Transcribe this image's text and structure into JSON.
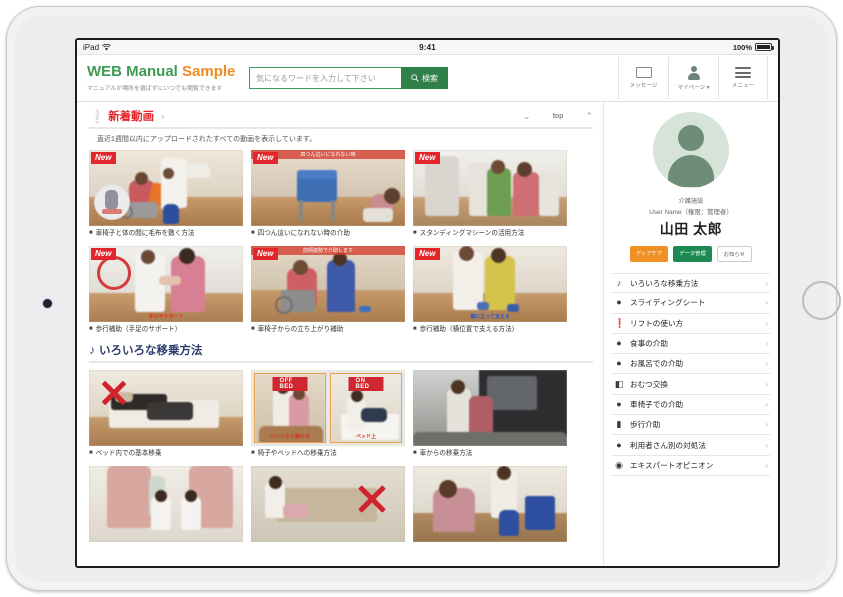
{
  "status_bar": {
    "carrier": "iPad",
    "wifi_icon": "wifi-icon",
    "time": "9:41",
    "battery_percent": "100%"
  },
  "header": {
    "brand_web": "WEB ",
    "brand_manual": "Manual ",
    "brand_sample": "Sample",
    "brand_subtitle": "マニュアルが場所を選ばずにいつでも閲覧できます",
    "search": {
      "placeholder": "気になるワードを入力して下さい",
      "value": "",
      "button_label": "検索",
      "button_icon": "search-icon"
    },
    "tools": [
      {
        "icon": "envelope-icon",
        "label": "メッセージ"
      },
      {
        "icon": "person-icon",
        "label": "マイページ ▾"
      },
      {
        "icon": "hamburger-icon",
        "label": "メニュー"
      }
    ]
  },
  "sections": [
    {
      "icon": "exclamation-icon",
      "title": "新着動画",
      "chevron": "›",
      "description": "直近1週間以内にアップロードされたすべての動画を表示しています。",
      "controls": {
        "down": "⌄",
        "top": "top",
        "up": "⌃"
      },
      "rows": [
        [
          {
            "badge": "New",
            "caption": "車椅子と体の間に毛布を敷く方法"
          },
          {
            "badge": "New",
            "caption": "四つん這いになれない時の介助"
          },
          {
            "badge": "New",
            "caption": "スタンディングマシーンの活用方法"
          }
        ],
        [
          {
            "badge": "New",
            "caption": "歩行補助（手足のサポート）"
          },
          {
            "badge": "New",
            "caption": "車椅子からの立ち上がり補助"
          },
          {
            "badge": "New",
            "caption": "歩行補助（横位置で支える方法）"
          }
        ]
      ]
    },
    {
      "icon": "note-icon",
      "title": "いろいろな移乗方法",
      "rows": [
        [
          {
            "badge": "",
            "caption": "ベッド内での基本移乗"
          },
          {
            "badge": "",
            "caption": "椅子やベッドへの移乗方法",
            "tag_left": "OFF BED",
            "tag_right": "ON BED"
          },
          {
            "badge": "",
            "caption": "車からの移乗方法"
          }
        ]
      ]
    }
  ],
  "profile": {
    "avatar_icon": "avatar-icon",
    "organization": "介護施設",
    "user_line": "User Name（権限：管理者）",
    "name": "山田 太郎",
    "badges": [
      {
        "label": "ディアケア",
        "color": "#ef9023"
      },
      {
        "label": "データ管理",
        "color": "#1e8a52"
      },
      {
        "label": "お知らせ",
        "color": "#ffffff"
      }
    ]
  },
  "sidebar_nav": [
    {
      "icon": "♪",
      "icon_name": "note-icon",
      "label": "いろいろな移乗方法",
      "chevron": "›"
    },
    {
      "icon": "●",
      "icon_name": "pin-icon",
      "label": "スライディングシート",
      "chevron": "›"
    },
    {
      "icon": "❗",
      "icon_name": "exclamation-icon",
      "label": "リフトの使い方",
      "chevron": "›"
    },
    {
      "icon": "●",
      "icon_name": "bowl-icon",
      "label": "食事の介助",
      "chevron": "›"
    },
    {
      "icon": "●",
      "icon_name": "bath-icon",
      "label": "お風呂での介助",
      "chevron": "›"
    },
    {
      "icon": "◧",
      "icon_name": "diaper-icon",
      "label": "おむつ交換",
      "chevron": "›"
    },
    {
      "icon": "●",
      "icon_name": "wheelchair-icon",
      "label": "車椅子での介助",
      "chevron": "›"
    },
    {
      "icon": "▮",
      "icon_name": "walk-icon",
      "label": "歩行介助",
      "chevron": "›"
    },
    {
      "icon": "●",
      "icon_name": "user-case-icon",
      "label": "利用者さん別の対処法",
      "chevron": "›"
    },
    {
      "icon": "◉",
      "icon_name": "expert-icon",
      "label": "エキスパートオピニオン",
      "chevron": "›"
    }
  ]
}
